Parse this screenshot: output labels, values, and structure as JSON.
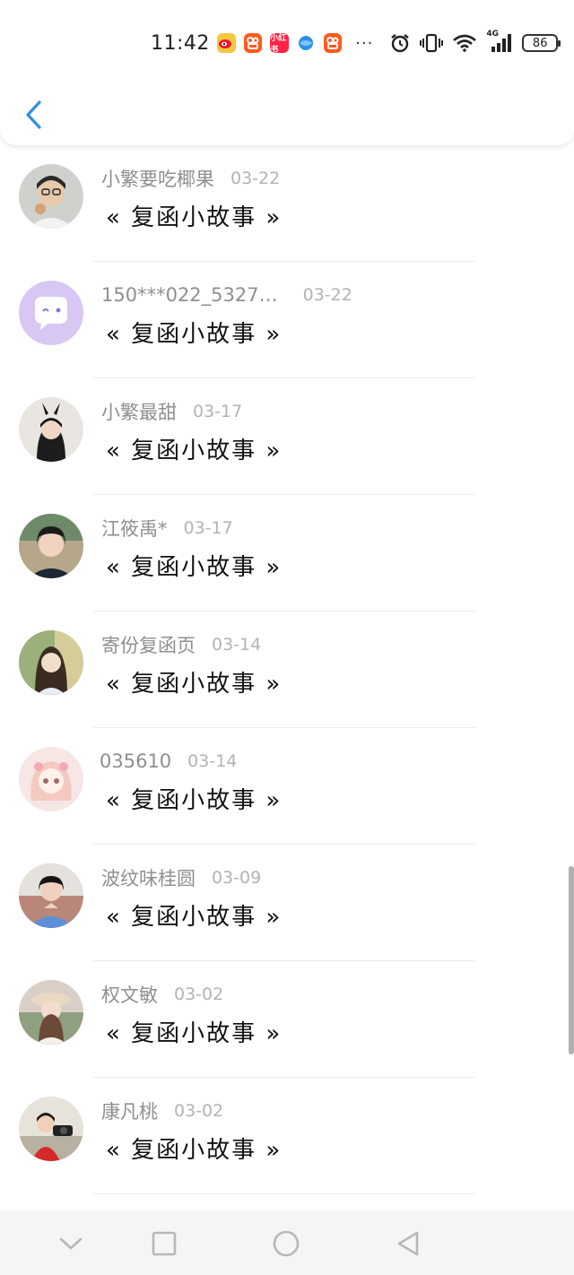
{
  "status_bar": {
    "time": "11:42",
    "battery": "86",
    "notification_icons": [
      "weibo-icon",
      "kuaishou-icon",
      "xiaohongshu-icon",
      "browser-icon",
      "kuaishou-icon"
    ],
    "xiaohongshu_label": "小红书",
    "more": "···",
    "network": "4G"
  },
  "header": {
    "back_icon": "chevron-left-icon"
  },
  "list": [
    {
      "name": "小繁要吃椰果",
      "date": "03-22",
      "message": "« 复函小故事 »"
    },
    {
      "name": "150***022_5327…",
      "date": "03-22",
      "message": "« 复函小故事 »"
    },
    {
      "name": "小繁最甜",
      "date": "03-17",
      "message": "« 复函小故事 »"
    },
    {
      "name": "江筱禹*",
      "date": "03-17",
      "message": "« 复函小故事 »"
    },
    {
      "name": "寄份复函页",
      "date": "03-14",
      "message": "« 复函小故事 »"
    },
    {
      "name": "035610",
      "date": "03-14",
      "message": "« 复函小故事 »"
    },
    {
      "name": "波纹味桂圆",
      "date": "03-09",
      "message": "« 复函小故事 »"
    },
    {
      "name": "权文敏",
      "date": "03-02",
      "message": "« 复函小故事 »"
    },
    {
      "name": "康凡桃",
      "date": "03-02",
      "message": "« 复函小故事 »"
    }
  ],
  "nav": {
    "icons": [
      "chevron-down-icon",
      "square-icon",
      "circle-icon",
      "triangle-back-icon"
    ]
  },
  "colors": {
    "accent": "#2f8fe8",
    "name_gray": "#8f8f8f",
    "date_gray": "#b3b3b3"
  }
}
